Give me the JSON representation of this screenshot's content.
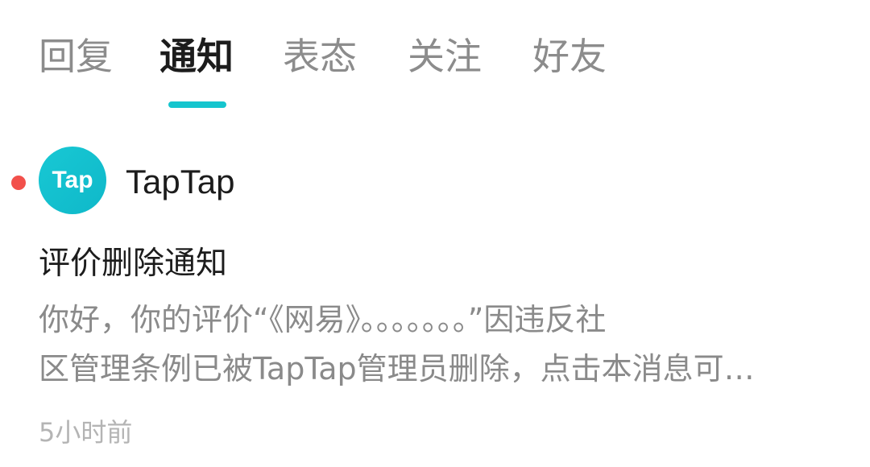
{
  "tabs": [
    {
      "label": "回复",
      "active": false
    },
    {
      "label": "通知",
      "active": true
    },
    {
      "label": "表态",
      "active": false
    },
    {
      "label": "关注",
      "active": false
    },
    {
      "label": "好友",
      "active": false
    }
  ],
  "colors": {
    "accent": "#15c5ce",
    "unread_dot": "#f2504b",
    "text_primary": "#1c1c1c",
    "text_secondary": "#8a8a8a",
    "text_muted": "#b4b4b4"
  },
  "notification": {
    "unread": true,
    "avatar_icon": "taptap-logo-icon",
    "avatar_text": "Tap",
    "sender": "TapTap",
    "title": "评价删除通知",
    "body": "你好，你的评价“《网易》。。。。。。。”因违反社\n区管理条例已被TapTap管理员删除，点击本消息可…",
    "time": "5小时前"
  }
}
